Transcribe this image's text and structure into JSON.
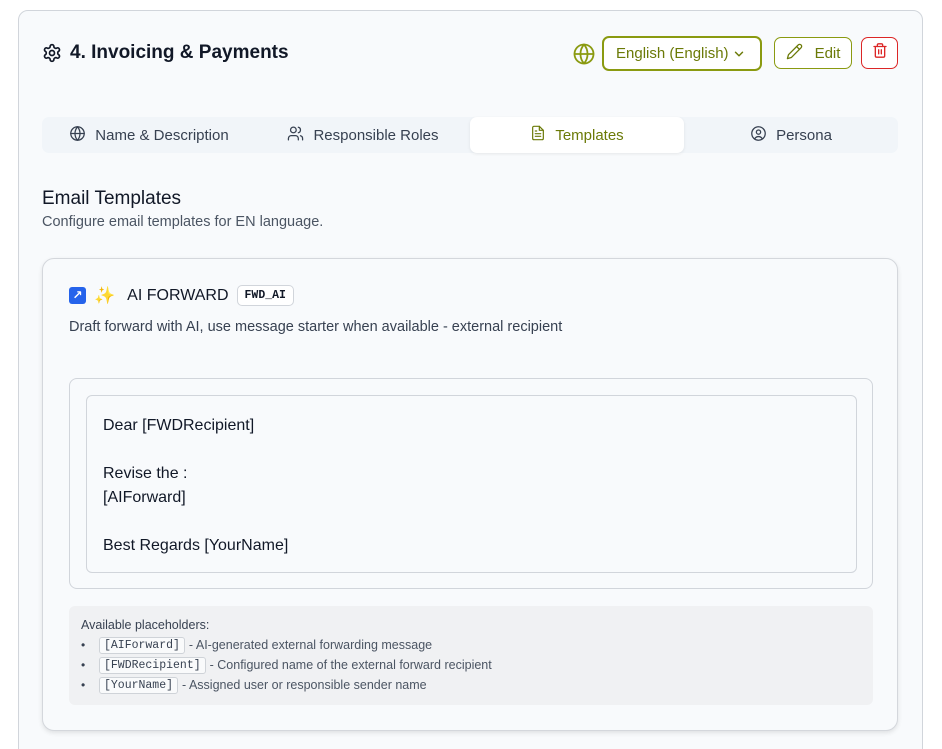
{
  "header": {
    "title": "4. Invoicing & Payments",
    "language_label": "English (English)",
    "edit_label": "Edit"
  },
  "tabs": [
    {
      "label": "Name & Description",
      "icon": "globe-icon"
    },
    {
      "label": "Responsible Roles",
      "icon": "users-icon"
    },
    {
      "label": "Templates",
      "icon": "document-icon",
      "active": true
    },
    {
      "label": "Persona",
      "icon": "user-circle-icon"
    }
  ],
  "section": {
    "title": "Email Templates",
    "subtitle": "Configure email templates for EN language."
  },
  "template": {
    "name": "AI FORWARD",
    "code": "FWD_AI",
    "description": "Draft forward with AI, use message starter when available - external recipient",
    "body_lines": [
      "Dear [FWDRecipient]",
      "",
      "Revise the :",
      "[AIForward]",
      "",
      "Best Regards [YourName]"
    ]
  },
  "placeholders": {
    "title": "Available placeholders:",
    "items": [
      {
        "code": "[AIForward]",
        "text": "- AI-generated external forwarding message"
      },
      {
        "code": "[FWDRecipient]",
        "text": "- Configured name of the external forward recipient"
      },
      {
        "code": "[YourName]",
        "text": "- Assigned user or responsible sender name"
      }
    ]
  },
  "colors": {
    "accent": "#6b7a07",
    "danger": "#dc2626"
  }
}
